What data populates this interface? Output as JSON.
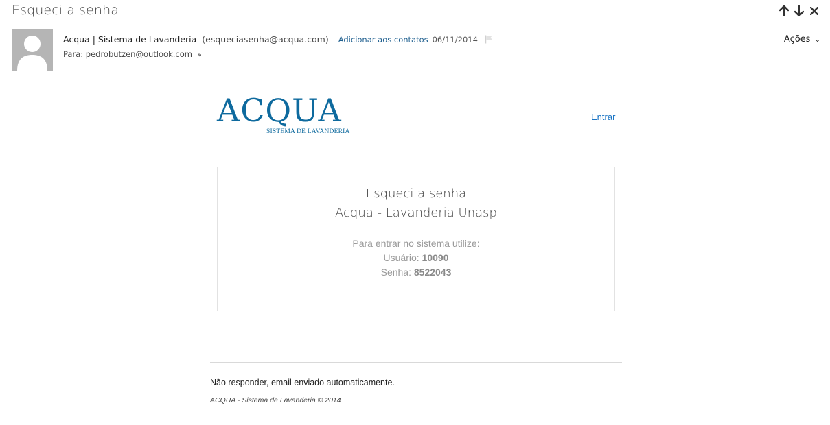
{
  "message": {
    "subject": "Esqueci a senha",
    "sender_name": "Acqua | Sistema de Lavanderia",
    "sender_email": "(esqueciasenha@acqua.com)",
    "add_contact_label": "Adicionar aos contatos",
    "date": "06/11/2014",
    "to_label": "Para:",
    "to_address": "pedrobutzen@outlook.com",
    "actions_label": "Ações"
  },
  "icons": {
    "prev": "arrow-up-icon",
    "next": "arrow-down-icon",
    "close": "close-icon",
    "flag": "flag-icon",
    "avatar": "person-silhouette-icon"
  },
  "email_body": {
    "logo_main": "ACQUA",
    "logo_sub": "SISTEMA DE LAVANDERIA",
    "entrar_label": "Entrar",
    "card_title": "Esqueci a senha",
    "card_subtitle": "Acqua - Lavanderia Unasp",
    "instructions": "Para entrar no sistema utilize:",
    "user_label": "Usuário:",
    "user_value": "10090",
    "password_label": "Senha:",
    "password_value": "8522043",
    "footer_note": "Não responder, email enviado automaticamente.",
    "footer_copy": "ACQUA - Sistema de Lavanderia © 2014"
  },
  "colors": {
    "brand_blue": "#0e6a9e",
    "link_blue": "#1a74c4",
    "avatar_gray": "#b5b5b5"
  }
}
